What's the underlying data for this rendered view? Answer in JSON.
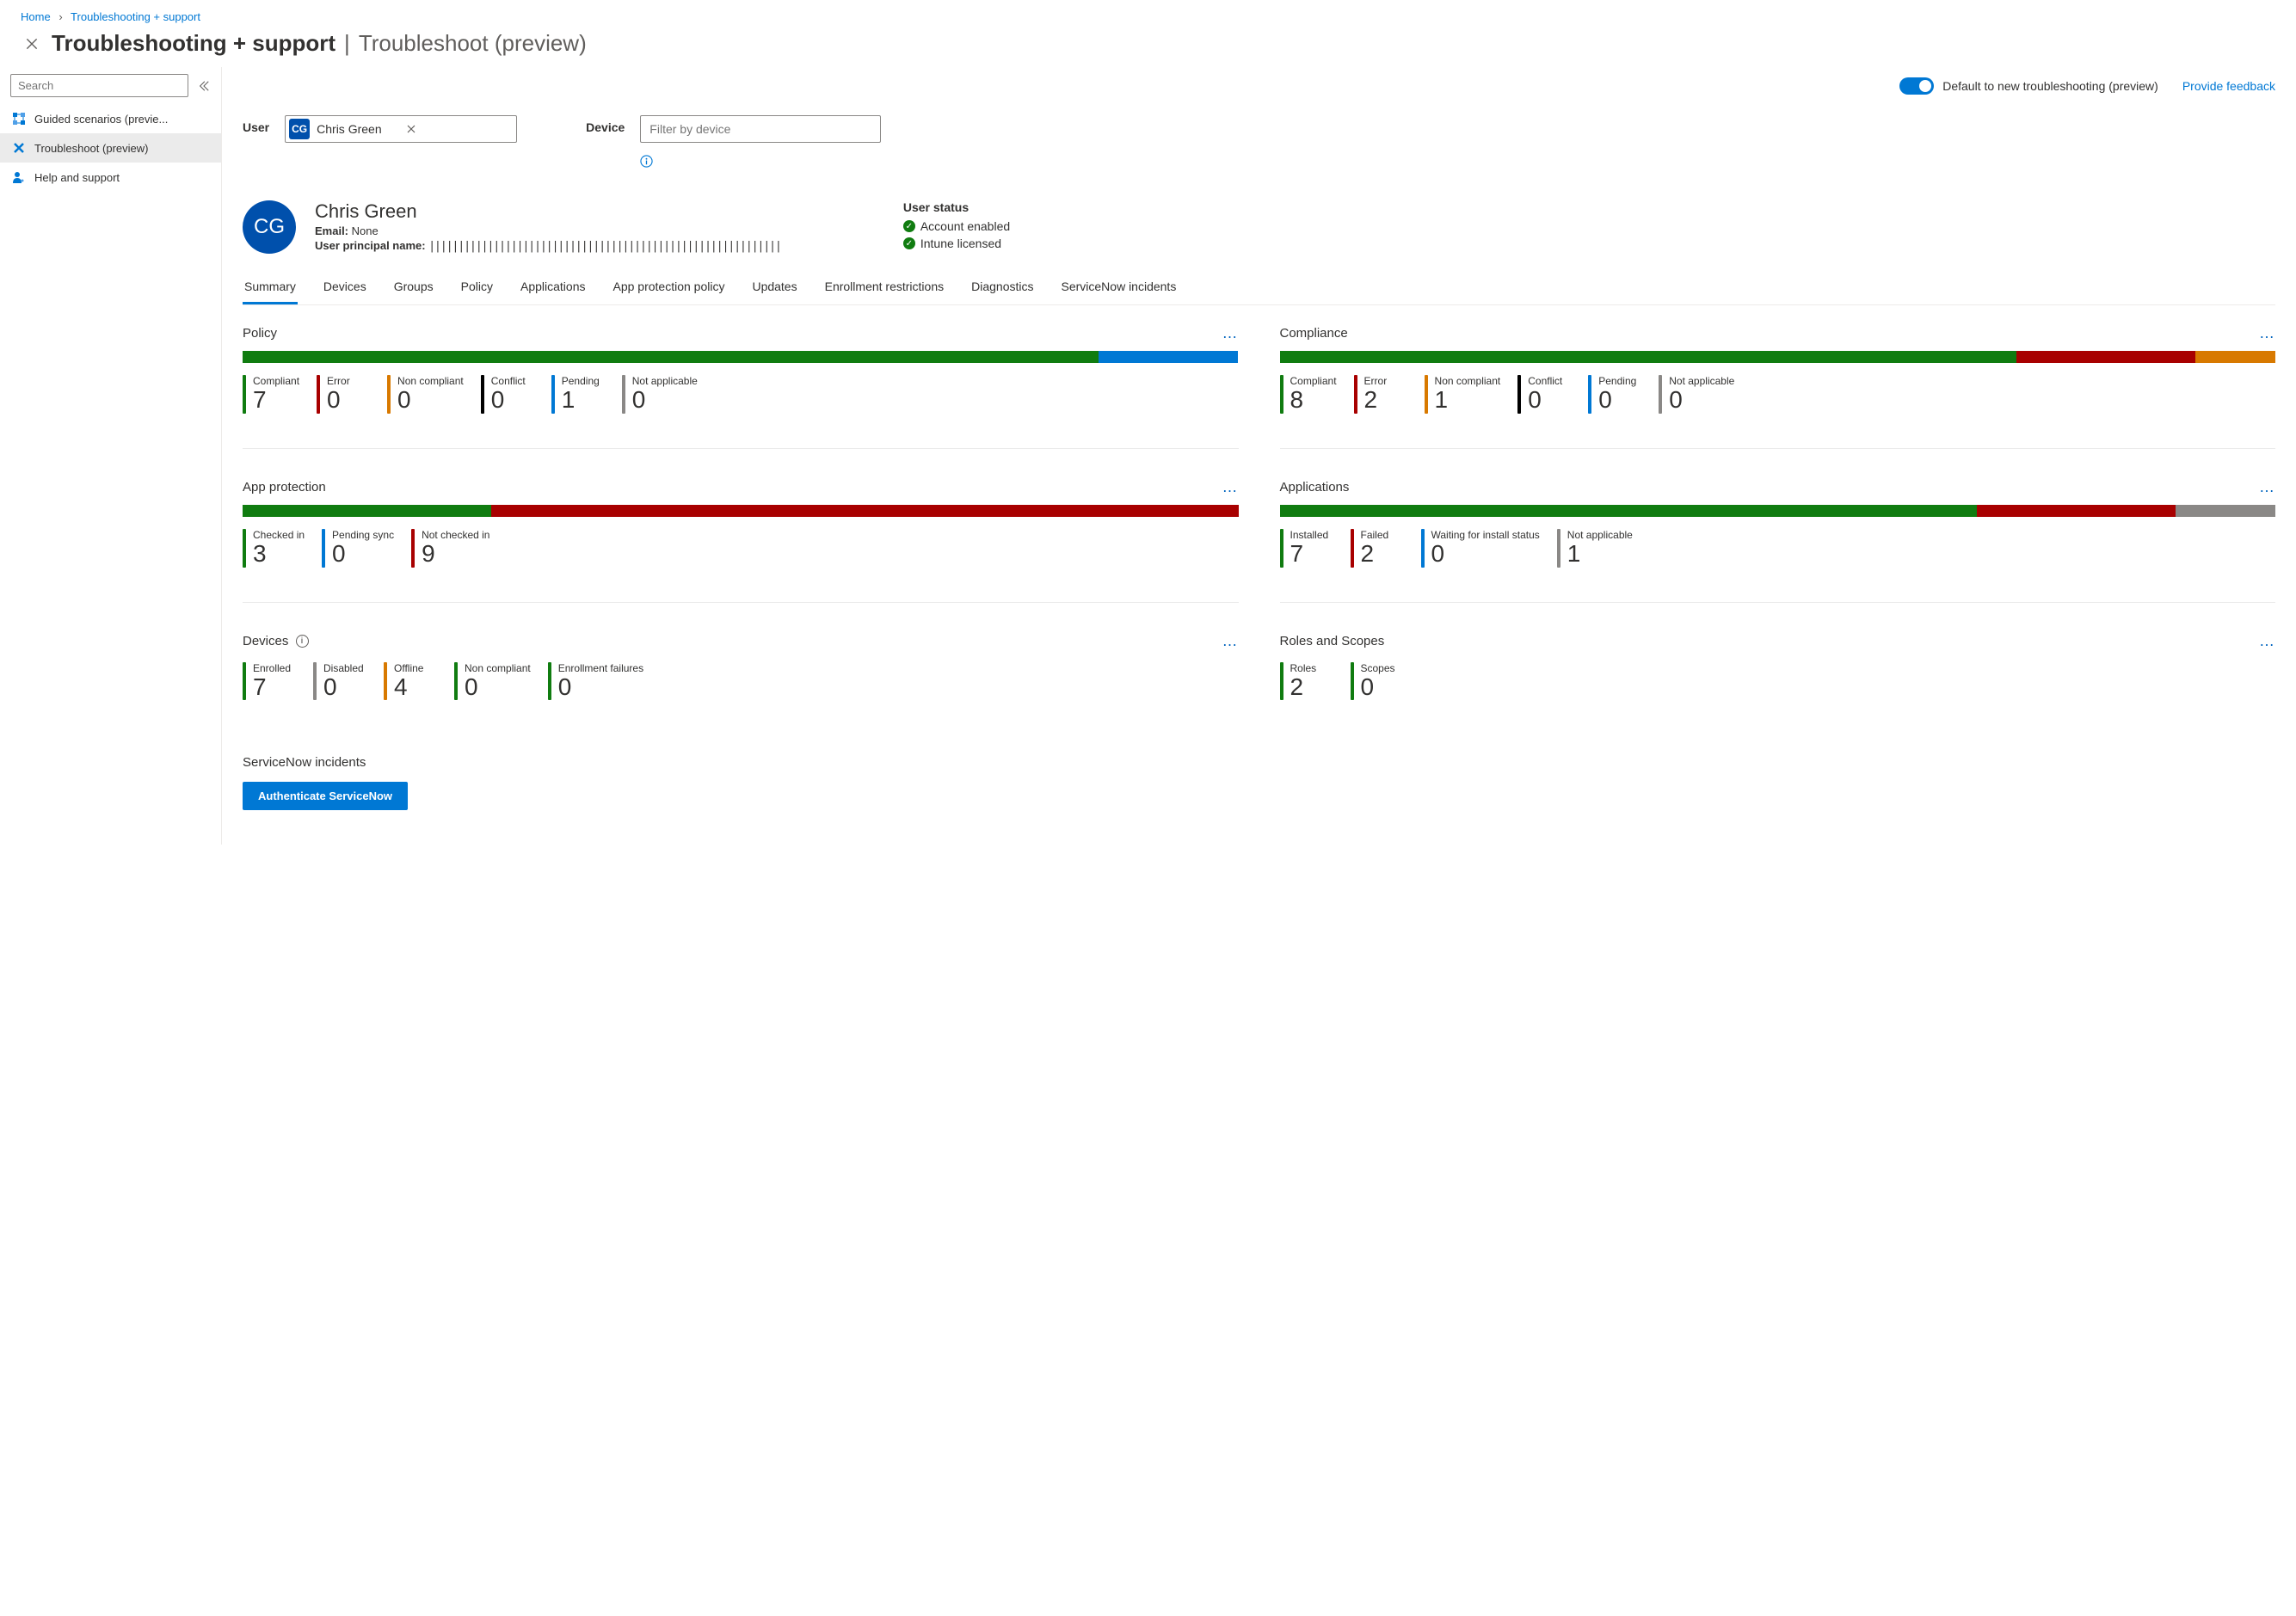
{
  "breadcrumb": {
    "home": "Home",
    "current": "Troubleshooting + support"
  },
  "page_title": {
    "main": "Troubleshooting + support",
    "sub": "Troubleshoot (preview)"
  },
  "sidebar": {
    "search_placeholder": "Search",
    "items": [
      {
        "label": "Guided scenarios (previe..."
      },
      {
        "label": "Troubleshoot (preview)"
      },
      {
        "label": "Help and support"
      }
    ]
  },
  "toolbar": {
    "toggle_label": "Default to new troubleshooting (preview)",
    "feedback_label": "Provide feedback"
  },
  "filters": {
    "user_label": "User",
    "user_chip": {
      "initials": "CG",
      "name": "Chris Green"
    },
    "device_label": "Device",
    "device_placeholder": "Filter by device"
  },
  "user_header": {
    "initials": "CG",
    "name": "Chris Green",
    "email_label": "Email:",
    "email_value": "None",
    "upn_label": "User principal name:",
    "upn_value": "||||||||||||||||||||||||||||||||||||||||||||||||||||||||||||"
  },
  "user_status": {
    "title": "User status",
    "account": "Account enabled",
    "intune": "Intune licensed"
  },
  "tabs": {
    "items": [
      "Summary",
      "Devices",
      "Groups",
      "Policy",
      "Applications",
      "App protection policy",
      "Updates",
      "Enrollment restrictions",
      "Diagnostics",
      "ServiceNow incidents"
    ]
  },
  "cards": {
    "policy": {
      "title": "Policy",
      "stats": [
        {
          "label": "Compliant",
          "value": "7",
          "color": "#107c10"
        },
        {
          "label": "Error",
          "value": "0",
          "color": "#a80000"
        },
        {
          "label": "Non compliant",
          "value": "0",
          "color": "#d87900"
        },
        {
          "label": "Conflict",
          "value": "0",
          "color": "#000000"
        },
        {
          "label": "Pending",
          "value": "1",
          "color": "#0078d4"
        },
        {
          "label": "Not applicable",
          "value": "0",
          "color": "#8a8886"
        }
      ],
      "bar": [
        {
          "color": "#107c10",
          "w": 86
        },
        {
          "color": "#0078d4",
          "w": 14
        }
      ]
    },
    "compliance": {
      "title": "Compliance",
      "stats": [
        {
          "label": "Compliant",
          "value": "8",
          "color": "#107c10"
        },
        {
          "label": "Error",
          "value": "2",
          "color": "#a80000"
        },
        {
          "label": "Non compliant",
          "value": "1",
          "color": "#d87900"
        },
        {
          "label": "Conflict",
          "value": "0",
          "color": "#000000"
        },
        {
          "label": "Pending",
          "value": "0",
          "color": "#0078d4"
        },
        {
          "label": "Not applicable",
          "value": "0",
          "color": "#8a8886"
        }
      ],
      "bar": [
        {
          "color": "#107c10",
          "w": 74
        },
        {
          "color": "#a80000",
          "w": 18
        },
        {
          "color": "#d87900",
          "w": 8
        }
      ]
    },
    "app_protection": {
      "title": "App protection",
      "stats": [
        {
          "label": "Checked in",
          "value": "3",
          "color": "#107c10"
        },
        {
          "label": "Pending sync",
          "value": "0",
          "color": "#0078d4"
        },
        {
          "label": "Not checked in",
          "value": "9",
          "color": "#a80000"
        }
      ],
      "bar": [
        {
          "color": "#107c10",
          "w": 25
        },
        {
          "color": "#a80000",
          "w": 75
        }
      ]
    },
    "applications": {
      "title": "Applications",
      "stats": [
        {
          "label": "Installed",
          "value": "7",
          "color": "#107c10"
        },
        {
          "label": "Failed",
          "value": "2",
          "color": "#a80000"
        },
        {
          "label": "Waiting for install status",
          "value": "0",
          "color": "#0078d4"
        },
        {
          "label": "Not applicable",
          "value": "1",
          "color": "#8a8886"
        }
      ],
      "bar": [
        {
          "color": "#107c10",
          "w": 70
        },
        {
          "color": "#a80000",
          "w": 20
        },
        {
          "color": "#8a8886",
          "w": 10
        }
      ]
    },
    "devices": {
      "title": "Devices",
      "stats": [
        {
          "label": "Enrolled",
          "value": "7",
          "color": "#107c10"
        },
        {
          "label": "Disabled",
          "value": "0",
          "color": "#8a8886"
        },
        {
          "label": "Offline",
          "value": "4",
          "color": "#d87900"
        },
        {
          "label": "Non compliant",
          "value": "0",
          "color": "#107c10"
        },
        {
          "label": "Enrollment failures",
          "value": "0",
          "color": "#107c10"
        }
      ]
    },
    "roles": {
      "title": "Roles and Scopes",
      "stats": [
        {
          "label": "Roles",
          "value": "2",
          "color": "#107c10"
        },
        {
          "label": "Scopes",
          "value": "0",
          "color": "#107c10"
        }
      ]
    }
  },
  "servicenow": {
    "title": "ServiceNow incidents",
    "button": "Authenticate ServiceNow"
  }
}
